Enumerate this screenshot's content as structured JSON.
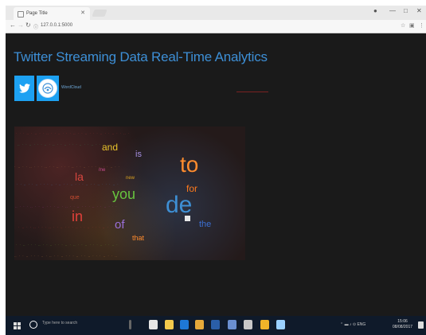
{
  "browser": {
    "tab_title": "Page Title",
    "url": "127.0.0.1:5000"
  },
  "page": {
    "title": "Twitter Streaming Data Real-Time Analytics",
    "logo_caption": "WordCloud"
  },
  "wordcloud": {
    "words": [
      {
        "text": "de",
        "color": "#3e8fd4"
      },
      {
        "text": "to",
        "color": "#ff8c2e"
      },
      {
        "text": "you",
        "color": "#67c43f"
      },
      {
        "text": "in",
        "color": "#e0403a"
      },
      {
        "text": "la",
        "color": "#d7463f"
      },
      {
        "text": "and",
        "color": "#e9c32c"
      },
      {
        "text": "for",
        "color": "#ff7a1c"
      },
      {
        "text": "of",
        "color": "#9a6fd8"
      },
      {
        "text": "the",
        "color": "#3c6fd1"
      },
      {
        "text": "is",
        "color": "#a58ee0"
      },
      {
        "text": "that",
        "color": "#ff8c2e"
      },
      {
        "text": "que",
        "color": "#c94b31"
      },
      {
        "text": "new",
        "color": "#d9a020"
      },
      {
        "text": "me",
        "color": "#c74c8e"
      }
    ]
  },
  "taskbar": {
    "search_placeholder": "Type here to search",
    "time": "15:06",
    "date": "08/08/2017",
    "lang": "ENG"
  }
}
